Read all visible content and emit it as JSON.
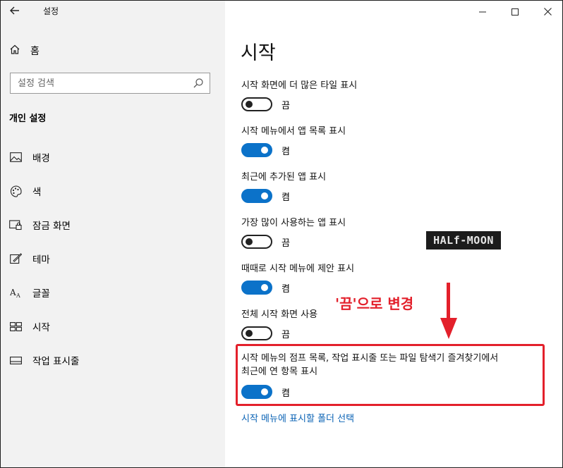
{
  "titlebar": {
    "app_title": "설정",
    "back_icon": "arrow-left-icon",
    "minimize_icon": "minimize-icon",
    "maximize_icon": "maximize-icon",
    "close_icon": "close-icon"
  },
  "sidebar": {
    "home_label": "홈",
    "search_placeholder": "설정 검색",
    "section_header": "개인 설정",
    "items": [
      {
        "label": "배경",
        "icon": "image-icon"
      },
      {
        "label": "색",
        "icon": "palette-icon"
      },
      {
        "label": "잠금 화면",
        "icon": "lock-screen-icon"
      },
      {
        "label": "테마",
        "icon": "theme-brush-icon"
      },
      {
        "label": "글꼴",
        "icon": "font-icon"
      },
      {
        "label": "시작",
        "icon": "start-tiles-icon"
      },
      {
        "label": "작업 표시줄",
        "icon": "taskbar-icon"
      }
    ]
  },
  "main": {
    "page_title": "시작",
    "settings": [
      {
        "label": "시작 화면에 더 많은 타일 표시",
        "state": "끔",
        "on": false
      },
      {
        "label": "시작 메뉴에서 앱 목록 표시",
        "state": "켬",
        "on": true
      },
      {
        "label": "최근에 추가된 앱 표시",
        "state": "켬",
        "on": true
      },
      {
        "label": "가장 많이 사용하는 앱 표시",
        "state": "끔",
        "on": false
      },
      {
        "label": "때때로 시작 메뉴에 제안 표시",
        "state": "켬",
        "on": true
      },
      {
        "label": "전체 시작 화면 사용",
        "state": "끔",
        "on": false
      }
    ],
    "jump_list": {
      "label_line1": "시작 메뉴의 점프 목록, 작업 표시줄 또는 파일 탐색기 즐겨찾기에서",
      "label_line2": "최근에 연 항목 표시",
      "state": "켬",
      "on": true
    },
    "link": "시작 메뉴에 표시할 폴더 선택",
    "annotation": "'끔'으로 변경",
    "watermark": "HALf-MOON",
    "colors": {
      "accent": "#0b72c9",
      "annotation": "#e3202b",
      "link": "#0b63b5"
    }
  }
}
